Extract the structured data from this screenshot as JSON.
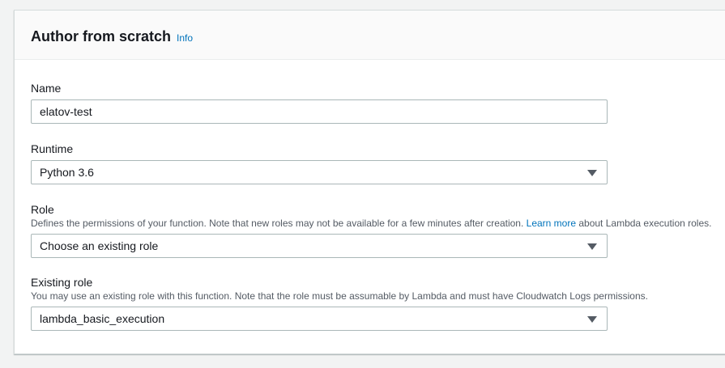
{
  "panel": {
    "title": "Author from scratch",
    "info_link": "Info"
  },
  "name_field": {
    "label": "Name",
    "value": "elatov-test"
  },
  "runtime_field": {
    "label": "Runtime",
    "selected": "Python 3.6",
    "caret_icon": "caret-down-icon"
  },
  "role_field": {
    "label": "Role",
    "description_before_link": "Defines the permissions of your function. Note that new roles may not be available for a few minutes after creation. ",
    "description_link": "Learn more",
    "description_after_link": " about Lambda execution roles.",
    "selected": "Choose an existing role",
    "caret_icon": "caret-down-icon"
  },
  "existing_role_field": {
    "label": "Existing role",
    "description": "You may use an existing role with this function. Note that the role must be assumable by Lambda and must have Cloudwatch Logs permissions.",
    "selected": "lambda_basic_execution",
    "caret_icon": "caret-down-icon"
  },
  "colors": {
    "link": "#0073bb",
    "border": "#aab7b8",
    "background": "#f2f3f3",
    "text": "#16191f",
    "secondary_text": "#545b64"
  }
}
